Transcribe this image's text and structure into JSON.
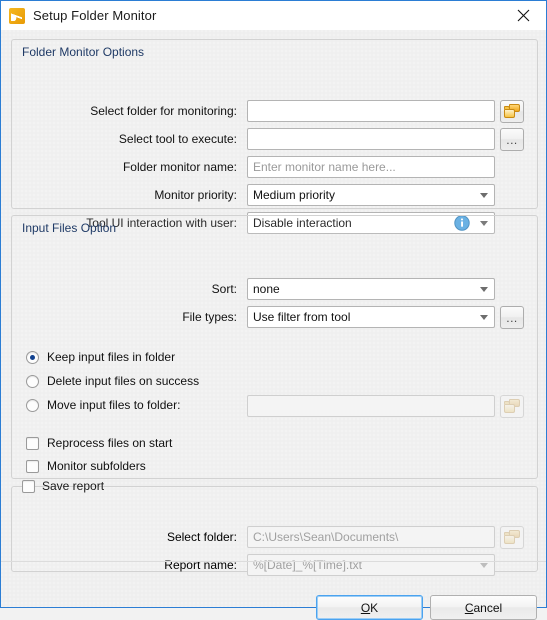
{
  "window": {
    "title": "Setup Folder Monitor",
    "app_icon": "pdfxchange-icon",
    "close_icon": "close-icon"
  },
  "groups": {
    "folder_monitor_options": {
      "title": "Folder Monitor Options",
      "fields": {
        "select_folder_label": "Select folder for monitoring:",
        "select_folder_value": "",
        "select_folder_browse_icon": "folder-browse-icon",
        "select_tool_label": "Select tool to execute:",
        "select_tool_value": "",
        "select_tool_browse_label": "...",
        "monitor_name_label": "Folder monitor name:",
        "monitor_name_placeholder": "Enter monitor name here...",
        "monitor_priority_label": "Monitor priority:",
        "monitor_priority_value": "Medium priority",
        "tool_ui_label": "Tool UI interaction with user:",
        "tool_ui_value": "Disable interaction",
        "tool_ui_info_icon": "info-icon"
      }
    },
    "input_files_option": {
      "title": "Input Files Option",
      "fields": {
        "sort_label": "Sort:",
        "sort_value": "none",
        "file_types_label": "File types:",
        "file_types_value": "Use filter from tool",
        "file_types_browse_label": "..."
      },
      "radios": [
        {
          "label": "Keep input files in folder",
          "checked": true
        },
        {
          "label": "Delete input files on success",
          "checked": false
        },
        {
          "label": "Move input files to folder:",
          "checked": false
        }
      ],
      "move_folder_value": "",
      "move_folder_browse_icon": "folder-browse-icon",
      "checkboxes": [
        {
          "label": "Reprocess files on start",
          "checked": false
        },
        {
          "label": "Monitor subfolders",
          "checked": false
        }
      ]
    },
    "save_report": {
      "title": "Save report",
      "checked": false,
      "fields": {
        "select_folder_label": "Select folder:",
        "select_folder_value": "C:\\Users\\Sean\\Documents\\",
        "select_folder_browse_icon": "folder-browse-icon",
        "report_name_label": "Report name:",
        "report_name_value": "%[Date]_%[Time].txt"
      }
    }
  },
  "footer": {
    "ok_prefix": "O",
    "ok_suffix": "K",
    "cancel_prefix": "C",
    "cancel_suffix": "ancel"
  },
  "colors": {
    "accent": "#2b7dd4",
    "group_title": "#1f3a66",
    "radio_dot": "#11418f",
    "folder_icon": "#f6c445",
    "info_icon": "#4a9ad6"
  }
}
